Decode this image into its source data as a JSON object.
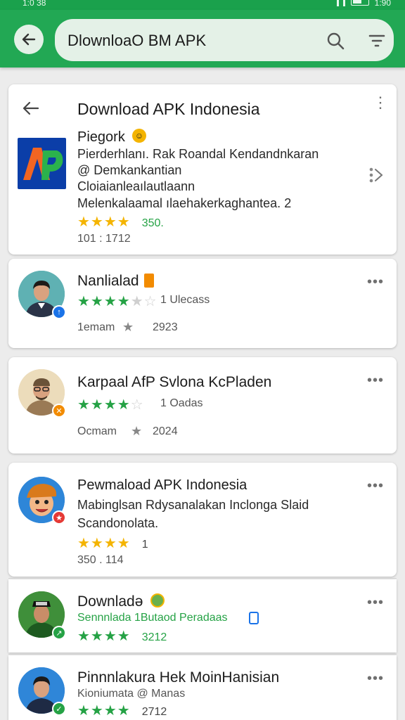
{
  "status_bar": {
    "left_text": "1:0 38",
    "right_text": "1:90"
  },
  "search": {
    "back_icon": "arrow-left-icon",
    "query": "DlownloaO BM APK",
    "search_icon": "search-icon",
    "filter_icon": "filter-icon"
  },
  "header_card": {
    "title": "Download APK Indonesia",
    "app_name": "Piegork",
    "description_lines": [
      "Pierderhlanı. Rak Roandal Kendandnkaran",
      "@ Demkankantian",
      "Cloiaianleaılautlaann",
      "Melenkalaamal ılaehakerkaghantea. 2"
    ],
    "rating": "350.",
    "footer": "101 :      1712"
  },
  "items": [
    {
      "name": "Nanlialad",
      "meta": "1  Ulecass",
      "footer_left": "1emam",
      "footer_right": "2923",
      "stars_color": "#25a245",
      "badge_color": "#1a73e8"
    },
    {
      "name": "Karpaal AfP Svlona KcPladen",
      "meta": "1  Oadas",
      "footer_left": "Ocmam",
      "footer_right": "2024",
      "stars_color": "#25a245",
      "badge_color": "#f28b00"
    },
    {
      "name": "Pewmaload APK Indonesia",
      "desc": "Mabinglsan Rdysanalakan Inclonga Slaid",
      "desc2": "Scandonolata.",
      "rating": "1",
      "footer": "350 .     114",
      "stars_color": "#f4b400",
      "badge_color": "#e53935"
    },
    {
      "name": "Downladə",
      "meta": "Sennnlada 1Butaod Peradaas",
      "rating": "3212",
      "stars_color": "#25a245",
      "badge_color": "#25a245"
    },
    {
      "name": "Pinnnlakura  Hek MoinHanisian",
      "meta": "Kioniumata @ Manas",
      "rating": "2712",
      "stars_color": "#25a245",
      "badge_color": "#25a245"
    }
  ],
  "colors": {
    "brand_green": "#22a854",
    "search_bg": "#e4f1e7",
    "star_gold": "#f4b400",
    "star_green": "#25a245"
  }
}
